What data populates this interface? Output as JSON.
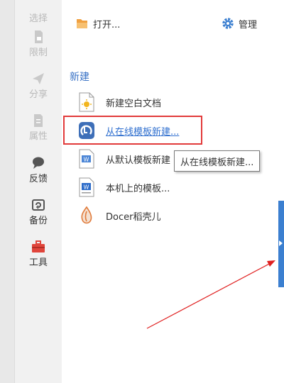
{
  "sidebar": {
    "items": [
      {
        "label": "选择",
        "icon": "select-icon",
        "enabled": false
      },
      {
        "label": "限制",
        "icon": "restrict-icon",
        "enabled": false
      },
      {
        "label": "分享",
        "icon": "share-icon",
        "enabled": false
      },
      {
        "label": "属性",
        "icon": "properties-icon",
        "enabled": false
      },
      {
        "label": "反馈",
        "icon": "feedback-icon",
        "enabled": true
      },
      {
        "label": "备份",
        "icon": "backup-icon",
        "enabled": true
      },
      {
        "label": "工具",
        "icon": "tools-icon",
        "enabled": true
      }
    ]
  },
  "main": {
    "open_label": "打开...",
    "manage_label": "管理",
    "section_title": "新建",
    "items": [
      {
        "label": "新建空白文档",
        "icon": "blank-document-icon"
      },
      {
        "label": "从在线模板新建...",
        "icon": "online-template-icon"
      },
      {
        "label": "从默认模板新建",
        "icon": "default-template-icon"
      },
      {
        "label": "本机上的模板...",
        "icon": "local-template-icon"
      },
      {
        "label": "Docer稻壳儿",
        "icon": "docer-icon"
      }
    ]
  },
  "tooltip": {
    "text": "从在线模板新建..."
  },
  "colors": {
    "accent": "#3b7fd0",
    "highlight": "#e23a3a",
    "link": "#2f6fcf"
  }
}
